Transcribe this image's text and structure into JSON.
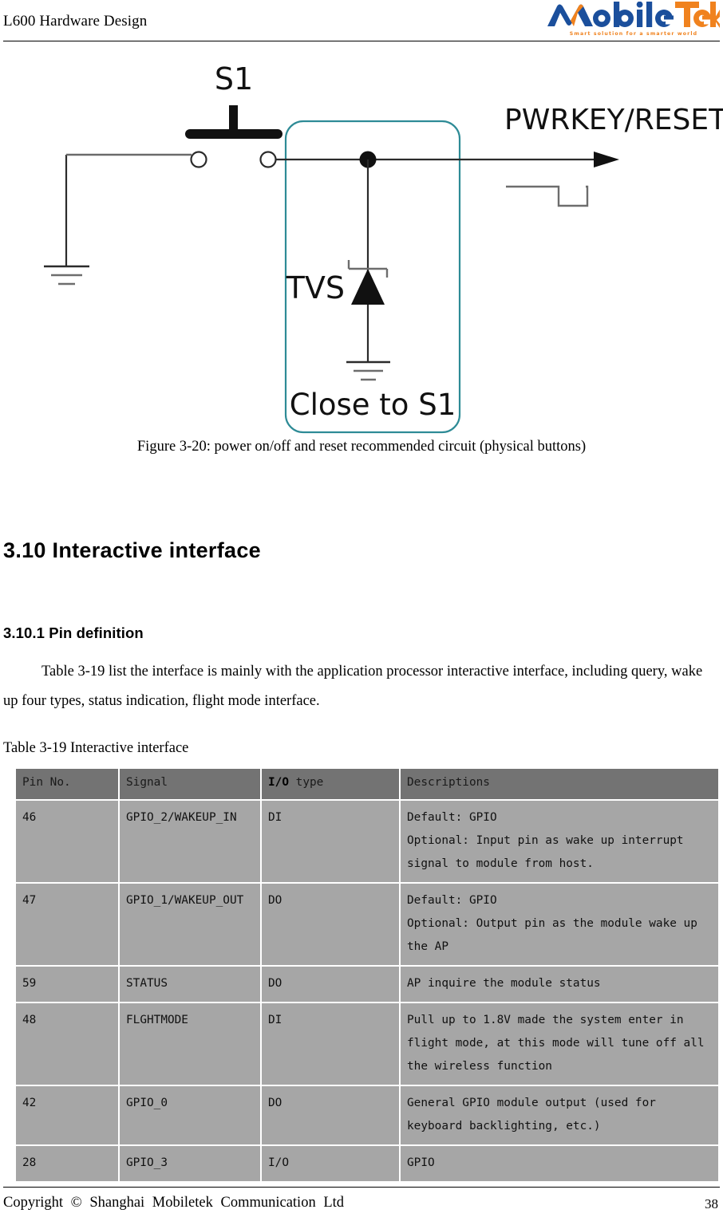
{
  "header": {
    "title": "L600 Hardware Design",
    "logo": {
      "name_part1": "M",
      "name_part2": "obile",
      "name_part3": "Tek",
      "tagline": "Smart solution for a smarter world",
      "color_blue": "#1b4f9c",
      "color_orange": "#f0821e"
    }
  },
  "figure": {
    "labels": {
      "switch": "S1",
      "tvs": "TVS",
      "note": "Close to S1",
      "signal": "PWRKEY/RESET"
    },
    "box_color": "#2e8b96",
    "caption": "Figure 3-20: power on/off and reset recommended circuit (physical buttons)"
  },
  "sections": {
    "heading_3_10": "3.10 Interactive interface",
    "heading_3_10_1": "3.10.1 Pin definition",
    "intro_paragraph": "Table 3-19 list the interface is mainly with the application processor interactive interface, including query, wake up four types, status indication, flight mode interface."
  },
  "table": {
    "caption": "Table 3-19 Interactive interface",
    "header_bg": "#737373",
    "row_bg": "#a6a6a6",
    "columns": [
      "Pin No.",
      "Signal",
      "I/O type",
      "Descriptions"
    ],
    "header_io_bold": "I/O",
    "header_io_rest": " type",
    "rows": [
      {
        "pin": "46",
        "signal": "GPIO_2/WAKEUP_IN",
        "io": "DI",
        "desc_lines": [
          "Default: GPIO",
          "Optional: Input pin as wake up interrupt",
          "signal to module from host."
        ]
      },
      {
        "pin": "47",
        "signal": "GPIO_1/WAKEUP_OUT",
        "io": "DO",
        "desc_lines": [
          "Default: GPIO",
          "Optional: Output pin as the module wake up",
          "the AP"
        ]
      },
      {
        "pin": "59",
        "signal": "STATUS",
        "io": "DO",
        "desc_lines": [
          "AP inquire the module status"
        ]
      },
      {
        "pin": "48",
        "signal": "FLGHTMODE",
        "io": "DI",
        "desc_lines": [
          "Pull up to 1.8V made the system enter in",
          "flight mode, at this mode will tune off all",
          "the wireless function"
        ]
      },
      {
        "pin": "42",
        "signal": "GPIO_0",
        "io": "DO",
        "desc_lines": [
          "General  GPIO  module  output  (used  for",
          "keyboard backlighting, etc.)"
        ]
      },
      {
        "pin": "28",
        "signal": "GPIO_3",
        "io": "I/O",
        "desc_lines": [
          "GPIO"
        ]
      }
    ]
  },
  "footer": {
    "copyright": "Copyright © Shanghai Mobiletek Communication Ltd",
    "page_number": "38"
  }
}
